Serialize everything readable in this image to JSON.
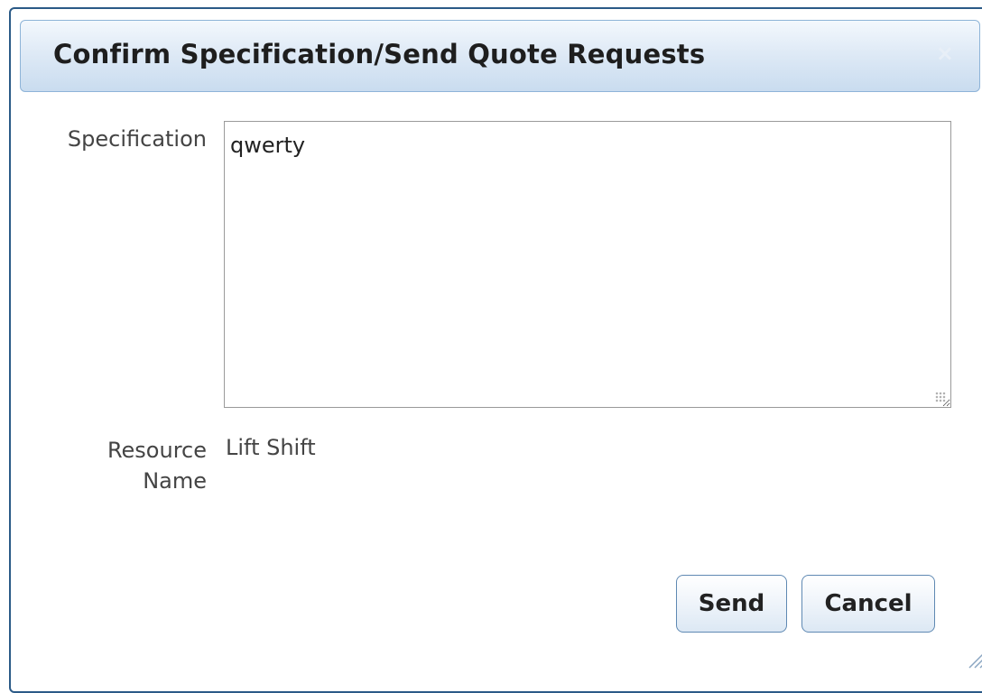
{
  "dialog": {
    "title": "Confirm Specification/Send Quote Requests",
    "close_label": "×"
  },
  "form": {
    "specification_label": "Specification",
    "specification_value": "qwerty",
    "resource_name_label": "Resource Name",
    "resource_name_value": "Lift Shift"
  },
  "buttons": {
    "send_label": "Send",
    "cancel_label": "Cancel"
  }
}
